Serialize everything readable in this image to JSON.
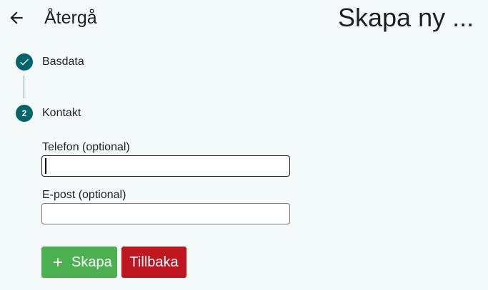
{
  "header": {
    "back_icon": "arrow-left-icon",
    "back_label": "Återgå",
    "title": "Skapa ny ..."
  },
  "stepper": {
    "steps": [
      {
        "label": "Basdata",
        "state": "completed",
        "icon": "check-icon"
      },
      {
        "label": "Kontakt",
        "state": "active",
        "number": "2"
      }
    ],
    "color": "#00646b"
  },
  "form": {
    "phone": {
      "label": "Telefon (optional)",
      "value": ""
    },
    "email": {
      "label": "E-post (optional)",
      "value": ""
    }
  },
  "actions": {
    "create_label": "Skapa",
    "create_icon": "plus-icon",
    "create_color": "#4caf50",
    "back_label": "Tillbaka",
    "back_color": "#c0161f"
  }
}
